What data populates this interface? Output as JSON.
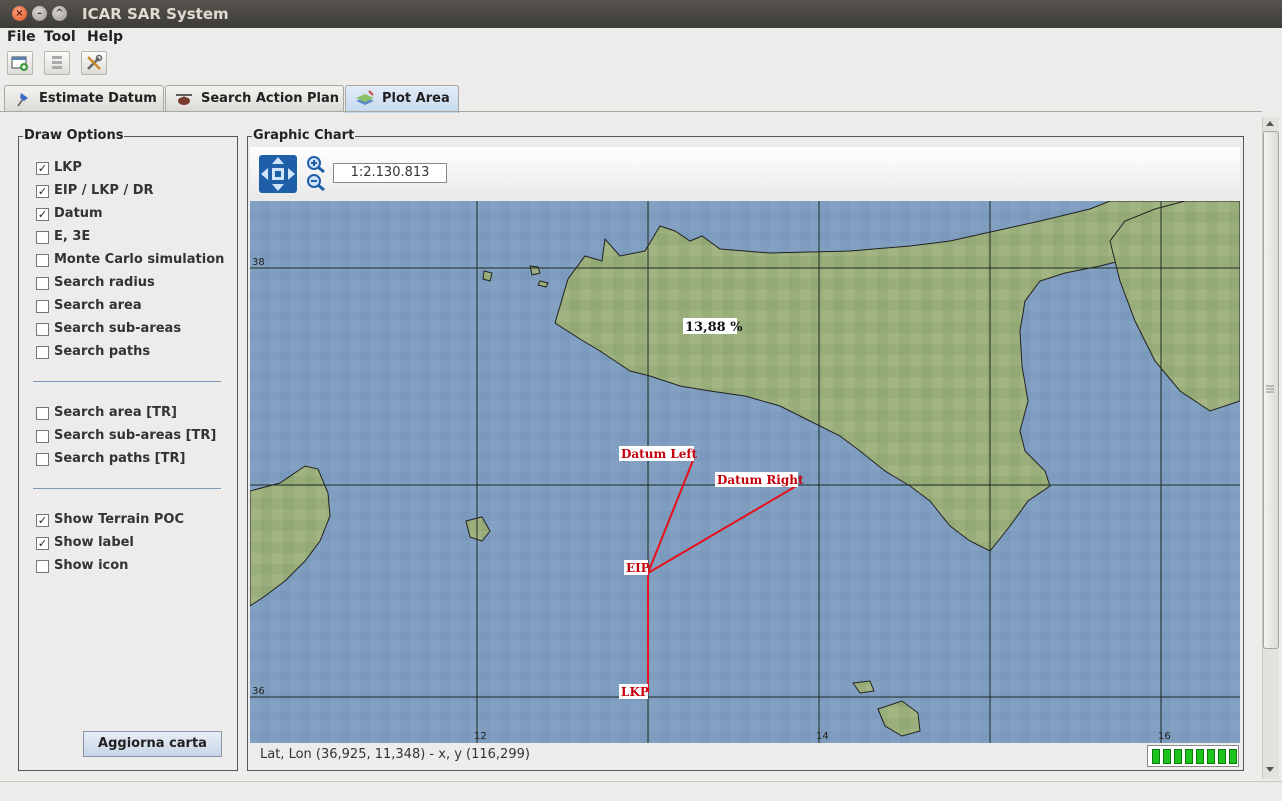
{
  "window": {
    "title": "ICAR SAR System",
    "close_glyph": "×",
    "min_glyph": "–",
    "max_glyph": "^"
  },
  "menu": {
    "file": "File",
    "tool": "Tool",
    "help": "Help"
  },
  "toolbar": {
    "icons": [
      "new-window-icon",
      "stack-icon",
      "tools-icon"
    ]
  },
  "tabs": [
    {
      "label": "Estimate Datum",
      "icon": "pushpin-icon"
    },
    {
      "label": "Search Action Plan",
      "icon": "helicopter-icon"
    },
    {
      "label": "Plot Area",
      "icon": "map-layers-icon",
      "selected": true
    }
  ],
  "draw_options": {
    "title": "Draw Options",
    "check_glyph": "✓",
    "group1": [
      {
        "label": "LKP",
        "checked": true
      },
      {
        "label": "EIP / LKP / DR",
        "checked": true
      },
      {
        "label": "Datum",
        "checked": true
      },
      {
        "label": "E, 3E",
        "checked": false
      },
      {
        "label": "Monte Carlo simulation",
        "checked": false
      },
      {
        "label": "Search radius",
        "checked": false
      },
      {
        "label": "Search area",
        "checked": false
      },
      {
        "label": "Search sub-areas",
        "checked": false
      },
      {
        "label": "Search paths",
        "checked": false
      }
    ],
    "group2": [
      {
        "label": "Search area [TR]",
        "checked": false
      },
      {
        "label": "Search sub-areas [TR]",
        "checked": false
      },
      {
        "label": "Search paths [TR]",
        "checked": false
      }
    ],
    "group3": [
      {
        "label": "Show Terrain POC",
        "checked": true
      },
      {
        "label": "Show label",
        "checked": true
      },
      {
        "label": "Show icon",
        "checked": false
      }
    ],
    "update_button": "Aggiorna carta"
  },
  "chart": {
    "title": "Graphic Chart",
    "scale": "1:2.130.813",
    "lat_labels": {
      "top": "38",
      "bottom": "36"
    },
    "lon_labels": {
      "a": "12",
      "b": "14",
      "c": "16"
    },
    "poc_label": "13,88 %",
    "points": {
      "datum_left": "Datum Left",
      "datum_right": "Datum Right",
      "eip": "EIP",
      "lkp": "LKP"
    },
    "status": "Lat, Lon (36,925, 11,348) - x, y (116,299)",
    "memory_cells": 8
  },
  "colors": {
    "sea": "#7f9dbf",
    "land": "#9aae7c",
    "track": "#e8101a",
    "grid": "#1d2a22"
  }
}
